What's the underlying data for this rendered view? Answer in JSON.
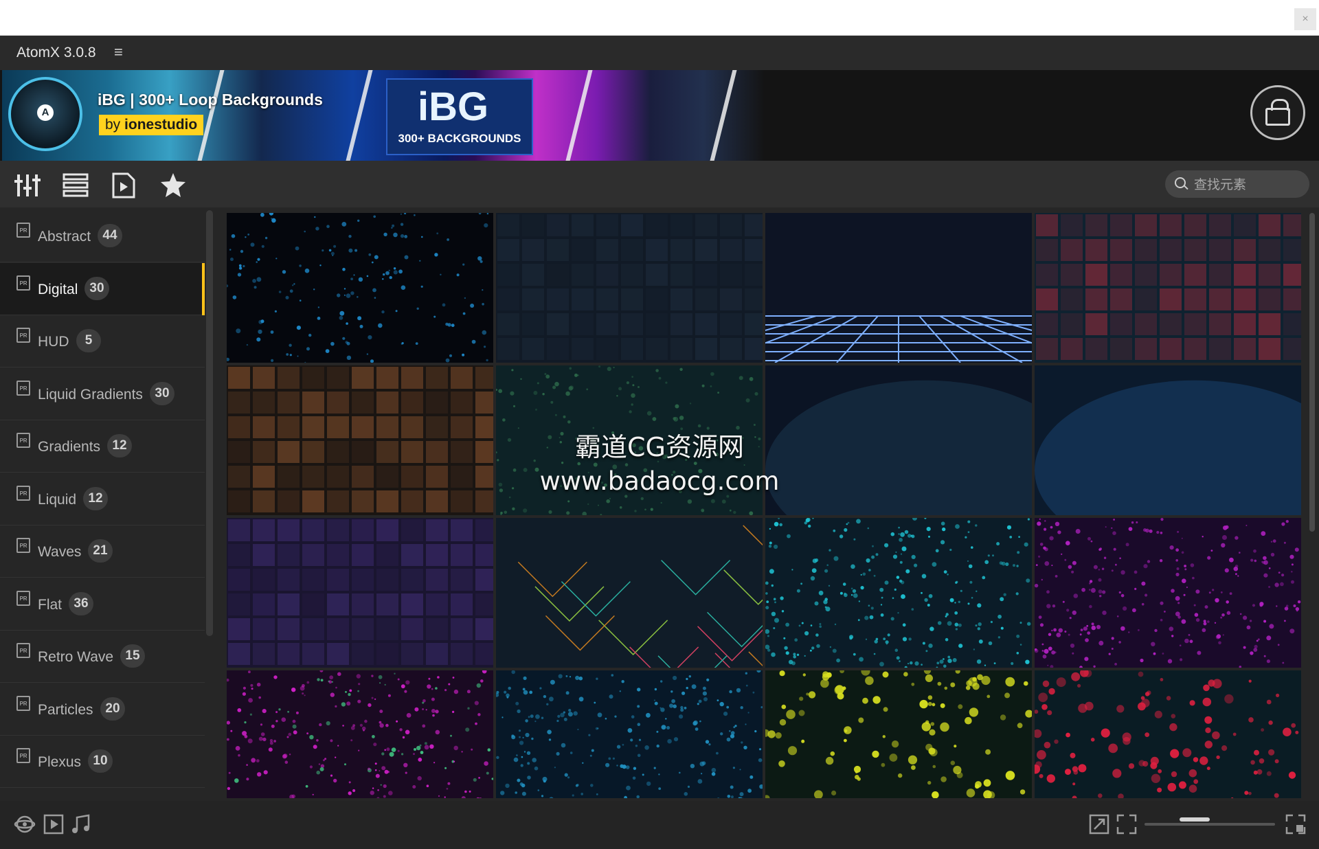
{
  "app": {
    "title": "AtomX 3.0.8",
    "menu_glyph": "≡",
    "close_glyph": "×"
  },
  "banner": {
    "title": "iBG | 300+ Loop Backgrounds",
    "by_prefix": "by",
    "author": "ionestudio",
    "logo_letter": "A",
    "art_big": "iBG",
    "art_small": "300+ BACKGROUNDS"
  },
  "toolbar": {
    "icons": [
      "sliders-icon",
      "list-view-icon",
      "preview-icon",
      "favorites-star-icon"
    ]
  },
  "search": {
    "placeholder": "查找元素"
  },
  "categories": [
    {
      "label": "Abstract",
      "count": "44",
      "active": false
    },
    {
      "label": "Digital",
      "count": "30",
      "active": true
    },
    {
      "label": "HUD",
      "count": "5",
      "active": false
    },
    {
      "label": "Liquid Gradients",
      "count": "30",
      "active": false
    },
    {
      "label": "Gradients",
      "count": "12",
      "active": false
    },
    {
      "label": "Liquid",
      "count": "12",
      "active": false
    },
    {
      "label": "Waves",
      "count": "21",
      "active": false
    },
    {
      "label": "Flat",
      "count": "36",
      "active": false
    },
    {
      "label": "Retro Wave",
      "count": "15",
      "active": false
    },
    {
      "label": "Particles",
      "count": "20",
      "active": false
    },
    {
      "label": "Plexus",
      "count": "10",
      "active": false
    }
  ],
  "thumbnails": [
    {
      "style": "blue-particles",
      "colors": [
        "#05070d",
        "#1e88c8"
      ]
    },
    {
      "style": "dark-squares",
      "colors": [
        "#111a26",
        "#1d2b3b"
      ]
    },
    {
      "style": "neon-grid-floor",
      "colors": [
        "#0d1424",
        "#7fb0ff"
      ]
    },
    {
      "style": "red-blue-blocks",
      "colors": [
        "#0f2230",
        "#8a2a3a"
      ]
    },
    {
      "style": "orange-glow-blocks",
      "colors": [
        "#1a1512",
        "#7a4a2a"
      ]
    },
    {
      "style": "green-dust",
      "colors": [
        "#0d2226",
        "#2d6a4a"
      ]
    },
    {
      "style": "blue-gradient",
      "colors": [
        "#0b1424",
        "#1c3d58"
      ]
    },
    {
      "style": "blue-grid-glow",
      "colors": [
        "#0b1a2c",
        "#1a4a7a"
      ]
    },
    {
      "style": "purple-squares",
      "colors": [
        "#1a1530",
        "#3a2a6a"
      ]
    },
    {
      "style": "rainbow-lines",
      "colors": [
        "#101c28",
        "#c47a20"
      ]
    },
    {
      "style": "cyan-dots",
      "colors": [
        "#0b1c28",
        "#1ec0d0"
      ]
    },
    {
      "style": "magenta-dots",
      "colors": [
        "#1a0a2a",
        "#b020c0"
      ]
    },
    {
      "style": "pink-green-dots",
      "colors": [
        "#1a0a22",
        "#d020c8"
      ]
    },
    {
      "style": "blue-dots",
      "colors": [
        "#071828",
        "#2090c0"
      ]
    },
    {
      "style": "yellow-green-blobs",
      "colors": [
        "#0c1a14",
        "#d8e020"
      ]
    },
    {
      "style": "red-cyan-blobs",
      "colors": [
        "#0a1c24",
        "#e02040"
      ]
    }
  ],
  "watermark": {
    "line1": "霸道CG资源网",
    "line2": "www.badaocg.com"
  },
  "bottombar": {
    "left_icons": [
      "vr-icon",
      "video-icon",
      "music-icon"
    ],
    "right_icons": [
      "expand-icon",
      "fullscreen-icon",
      "layout-icon"
    ],
    "zoom_level": 0.35
  }
}
